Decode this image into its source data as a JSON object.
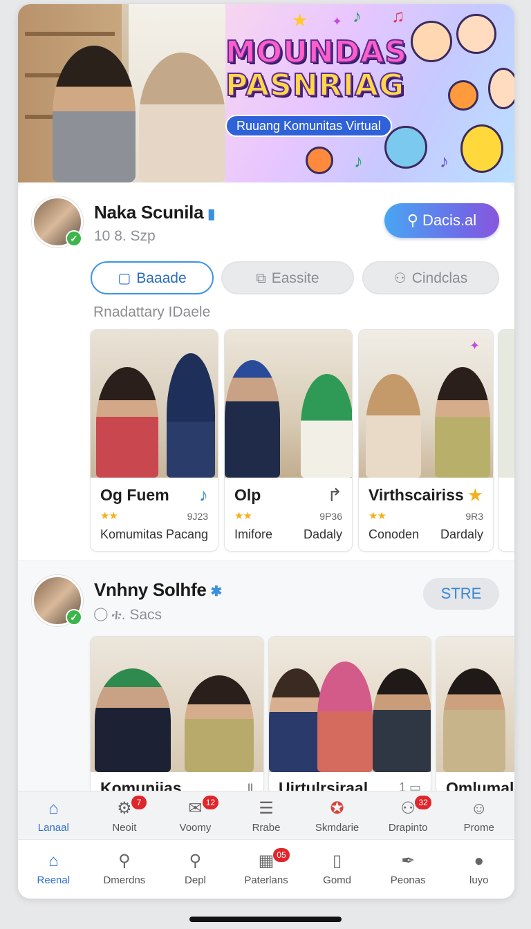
{
  "banner": {
    "title_line1": "MOUNDAS",
    "title_line2": "PASNRIAG",
    "subtitle": "Ruuang Komunitas Virtual"
  },
  "post1": {
    "user_name": "Naka Scunila",
    "verified_icon": "verified-icon",
    "meta": "10 8. Szp",
    "action_label": "Dacis.al",
    "tabs": [
      {
        "label": "Baaade",
        "icon": "bookmark-icon",
        "active": true
      },
      {
        "label": "Eassite",
        "icon": "copy-icon",
        "active": false
      },
      {
        "label": "Cindclas",
        "icon": "person-icon",
        "active": false
      }
    ],
    "section_label": "Rnadattary IDaele",
    "items": [
      {
        "title": "Og  Fuem",
        "icon": "music-note-icon",
        "stars": "★★",
        "count": "9J23",
        "left": "Komumitas",
        "right": "Pacang"
      },
      {
        "title": "Olp",
        "icon": "share-arrow-icon",
        "stars": "★★",
        "count": "9P36",
        "left": "Imifore",
        "right": "Dadaly"
      },
      {
        "title": "Virthscairiss",
        "icon": "star-icon",
        "stars": "★★",
        "count": "9R3",
        "left": "Conoden",
        "right": "Dardaly"
      }
    ]
  },
  "post2": {
    "user_name": "Vnhny Solhfe",
    "meta": "ቴ. Sacs",
    "action_label": "STRE",
    "items": [
      {
        "title": "Komunijas",
        "icon_text": "Ⅱ"
      },
      {
        "title": "Uirtulrsiraal",
        "icon_text": "1 ▭"
      },
      {
        "title": "Omlumal",
        "icon_text": ""
      }
    ]
  },
  "nav_top": [
    {
      "label": "Lanaal",
      "icon": "home-icon",
      "active": true,
      "badge": ""
    },
    {
      "label": "Neoit",
      "icon": "gear-icon",
      "active": false,
      "badge": "7"
    },
    {
      "label": "Voomy",
      "icon": "mail-icon",
      "active": false,
      "badge": "12"
    },
    {
      "label": "Rrabe",
      "icon": "list-icon",
      "active": false,
      "badge": ""
    },
    {
      "label": "Skmdarie",
      "icon": "badge-icon",
      "active": false,
      "badge": ""
    },
    {
      "label": "Drapinto",
      "icon": "people-icon",
      "active": false,
      "badge": "32"
    },
    {
      "label": "Prome",
      "icon": "profile-icon",
      "active": false,
      "badge": ""
    }
  ],
  "nav_bottom": [
    {
      "label": "Reenal",
      "icon": "home-icon",
      "active": true,
      "badge": ""
    },
    {
      "label": "Dmerdns",
      "icon": "search-icon",
      "active": false,
      "badge": ""
    },
    {
      "label": "Depl",
      "icon": "search-alt-icon",
      "active": false,
      "badge": ""
    },
    {
      "label": "Paterlans",
      "icon": "grid-icon",
      "active": false,
      "badge": "05"
    },
    {
      "label": "Gomd",
      "icon": "map-icon",
      "active": false,
      "badge": ""
    },
    {
      "label": "Peonas",
      "icon": "feather-icon",
      "active": false,
      "badge": ""
    },
    {
      "label": "luyo",
      "icon": "profile-filled-icon",
      "active": false,
      "badge": ""
    }
  ],
  "colors": {
    "accent": "#2f6fd0",
    "badge": "#e0262a",
    "verified": "#3cb54a",
    "star": "#f3b11d"
  }
}
